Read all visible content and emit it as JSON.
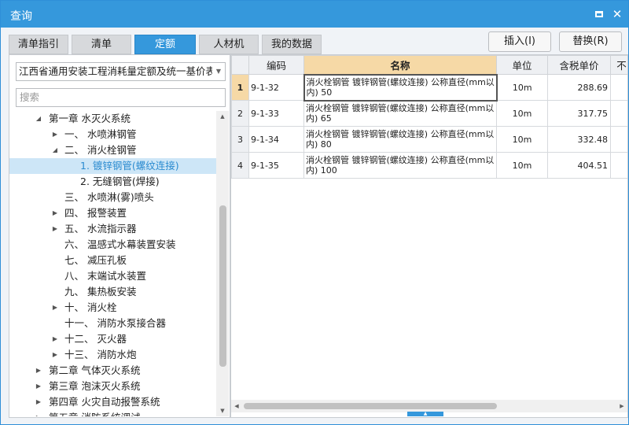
{
  "window": {
    "title": "查询"
  },
  "tabs": [
    {
      "label": "清单指引",
      "active": false
    },
    {
      "label": "清单",
      "active": false
    },
    {
      "label": "定额",
      "active": true
    },
    {
      "label": "人材机",
      "active": false
    },
    {
      "label": "我的数据",
      "active": false
    }
  ],
  "actions": {
    "insert_label": "插入(I)",
    "replace_label": "替换(R)"
  },
  "left": {
    "library_select": "江西省通用安装工程消耗量定额及统一基价表(",
    "search_placeholder": "搜索",
    "tree": [
      {
        "label": "第一章 水灭火系统",
        "expander": "expanded"
      },
      {
        "label": "一、 水喷淋钢管",
        "expander": "collapsed"
      },
      {
        "label": "二、 消火栓钢管",
        "expander": "expanded"
      },
      {
        "label": "1. 镀锌钢管(螺纹连接)",
        "expander": "none",
        "selected": true
      },
      {
        "label": "2. 无缝钢管(焊接)",
        "expander": "none"
      },
      {
        "label": "三、 水喷淋(雾)喷头",
        "expander": "none"
      },
      {
        "label": "四、 报警装置",
        "expander": "collapsed"
      },
      {
        "label": "五、 水流指示器",
        "expander": "collapsed"
      },
      {
        "label": "六、 温感式水幕装置安装",
        "expander": "none"
      },
      {
        "label": "七、 减压孔板",
        "expander": "none"
      },
      {
        "label": "八、 末端试水装置",
        "expander": "none"
      },
      {
        "label": "九、 集热板安装",
        "expander": "none"
      },
      {
        "label": "十、 消火栓",
        "expander": "collapsed"
      },
      {
        "label": "十一、 消防水泵接合器",
        "expander": "none"
      },
      {
        "label": "十二、 灭火器",
        "expander": "collapsed"
      },
      {
        "label": "十三、 消防水炮",
        "expander": "collapsed"
      },
      {
        "label": "第二章 气体灭火系统",
        "expander": "collapsed"
      },
      {
        "label": "第三章 泡沫灭火系统",
        "expander": "collapsed"
      },
      {
        "label": "第四章 火灾自动报警系统",
        "expander": "collapsed"
      },
      {
        "label": "第五章 消防系统调试",
        "expander": "collapsed"
      }
    ]
  },
  "grid": {
    "columns": [
      "编码",
      "名称",
      "单位",
      "含税单价",
      "不"
    ],
    "rows": [
      {
        "num": "1",
        "code": "9-1-32",
        "name": "消火栓钢管 镀锌钢管(螺纹连接) 公称直径(mm以内) 50",
        "unit": "10m",
        "price": "288.69"
      },
      {
        "num": "2",
        "code": "9-1-33",
        "name": "消火栓钢管 镀锌钢管(螺纹连接) 公称直径(mm以内) 65",
        "unit": "10m",
        "price": "317.75"
      },
      {
        "num": "3",
        "code": "9-1-34",
        "name": "消火栓钢管 镀锌钢管(螺纹连接) 公称直径(mm以内) 80",
        "unit": "10m",
        "price": "332.48"
      },
      {
        "num": "4",
        "code": "9-1-35",
        "name": "消火栓钢管 镀锌钢管(螺纹连接) 公称直径(mm以内) 100",
        "unit": "10m",
        "price": "404.51"
      }
    ]
  },
  "icons": {
    "maximize": "maximize-icon",
    "close": "close-icon",
    "dropdown": "chevron-down-icon",
    "expanded": "triangle-expanded-icon",
    "collapsed": "triangle-collapsed-icon"
  },
  "colors": {
    "accent": "#3598dc",
    "selection": "#cde6f7",
    "header_highlight": "#f6d9a6"
  }
}
